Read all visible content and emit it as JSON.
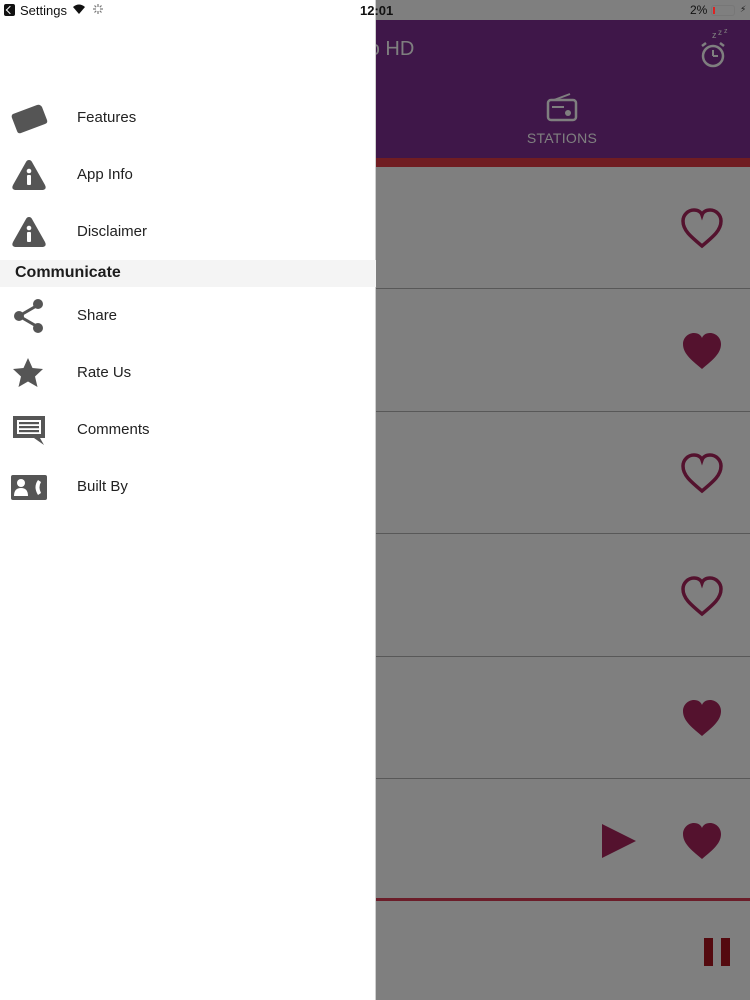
{
  "status_bar": {
    "back_app_label": "Settings",
    "time": "12:01",
    "battery_percent": "2%",
    "battery_level": 0.02
  },
  "app": {
    "title_fragment": "adio HD",
    "tab_stations_label": "STATIONS",
    "stations": [
      {
        "favorite": false,
        "playing": false
      },
      {
        "favorite": true,
        "playing": false
      },
      {
        "favorite": false,
        "playing": false
      },
      {
        "favorite": false,
        "playing": false
      },
      {
        "favorite": true,
        "playing": false
      },
      {
        "favorite": true,
        "playing": true
      }
    ]
  },
  "drawer": {
    "items_top": [
      {
        "label": "Features",
        "icon": "tag-icon"
      },
      {
        "label": "App Info",
        "icon": "info-icon"
      },
      {
        "label": "Disclaimer",
        "icon": "info-icon"
      }
    ],
    "section_title": "Communicate",
    "items_communicate": [
      {
        "label": "Share",
        "icon": "share-icon"
      },
      {
        "label": "Rate Us",
        "icon": "star-icon"
      },
      {
        "label": "Comments",
        "icon": "comment-icon"
      },
      {
        "label": "Built By",
        "icon": "contact-card-icon"
      }
    ]
  },
  "colors": {
    "header_purple": "#7e2f93",
    "accent_red": "#e13a45",
    "heart_magenta": "#a8245c",
    "icon_gray": "#555555"
  }
}
